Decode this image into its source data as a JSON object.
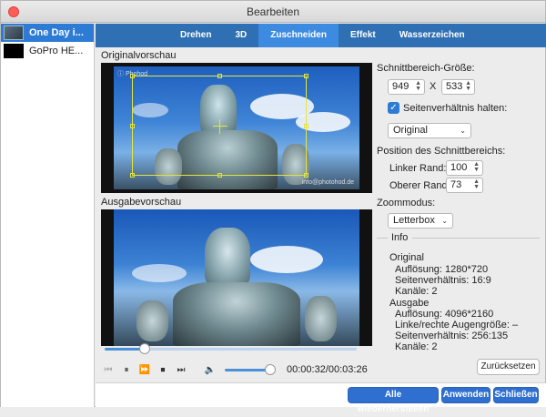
{
  "window": {
    "title": "Bearbeiten"
  },
  "sidebar": {
    "items": [
      {
        "name": "One Day i...",
        "selected": true
      },
      {
        "name": "GoPro HE...",
        "selected": false
      }
    ]
  },
  "tabs": [
    {
      "label": "Drehen",
      "active": false
    },
    {
      "label": "3D",
      "active": false
    },
    {
      "label": "Zuschneiden",
      "active": true
    },
    {
      "label": "Effekt",
      "active": false
    },
    {
      "label": "Wasserzeichen",
      "active": false
    }
  ],
  "preview": {
    "original_label": "Originalvorschau",
    "output_label": "Ausgabevorschau",
    "watermark_text": "info@photohod.de",
    "wm_topleft": "ⓘ Phohod"
  },
  "player": {
    "progress": 0.16,
    "volume": 1.0,
    "time": "00:00:32/00:03:26"
  },
  "crop": {
    "size_label": "Schnittbereich-Größe:",
    "width": "949",
    "x_sep": "X",
    "height": "533",
    "keep_ratio_label": "Seitenverhältnis halten:",
    "keep_ratio_checked": true,
    "ratio_value": "Original",
    "position_label": "Position des Schnittbereichs:",
    "left_margin_label": "Linker Rand:",
    "left_margin_value": "100",
    "top_margin_label": "Oberer Rand:",
    "top_margin_value": "73",
    "zoom_label": "Zoommodus:",
    "zoom_value": "Letterbox"
  },
  "info": {
    "header": "Info",
    "original_title": "Original",
    "orig_resolution": "Auflösung: 1280*720",
    "orig_ratio": "Seitenverhältnis: 16:9",
    "orig_channels": "Kanäle: 2",
    "output_title": "Ausgabe",
    "out_resolution": "Auflösung: 4096*2160",
    "out_eye": "Linke/rechte Augengröße: –",
    "out_ratio": "Seitenverhältnis: 256:135",
    "out_channels": "Kanäle: 2"
  },
  "buttons": {
    "reset": "Zurücksetzen",
    "restore_all": "Alle wiederherstellen",
    "apply": "Anwenden",
    "close": "Schließen"
  },
  "colors": {
    "accent": "#2e7bd6",
    "tabbar": "#2f6fb3",
    "crop": "#e5e53a"
  }
}
